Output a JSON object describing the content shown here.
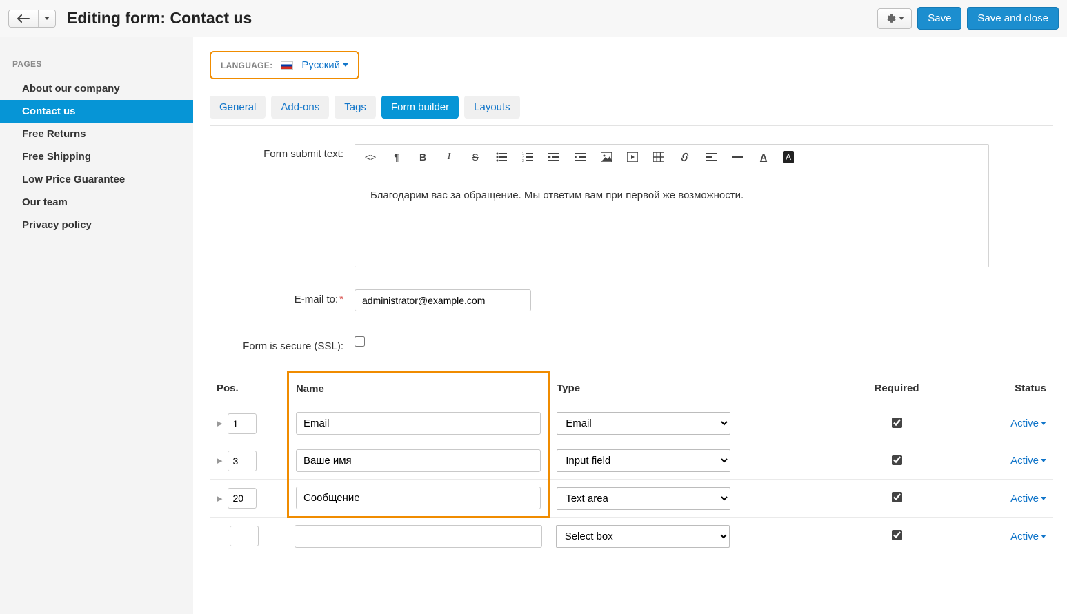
{
  "header": {
    "title": "Editing form: Contact us",
    "save_label": "Save",
    "save_close_label": "Save and close"
  },
  "sidebar": {
    "header": "PAGES",
    "items": [
      {
        "label": "About our company",
        "active": false
      },
      {
        "label": "Contact us",
        "active": true
      },
      {
        "label": "Free Returns",
        "active": false
      },
      {
        "label": "Free Shipping",
        "active": false
      },
      {
        "label": "Low Price Guarantee",
        "active": false
      },
      {
        "label": "Our team",
        "active": false
      },
      {
        "label": "Privacy policy",
        "active": false
      }
    ]
  },
  "language": {
    "label": "LANGUAGE:",
    "name": "Русский"
  },
  "tabs": [
    {
      "label": "General",
      "active": false
    },
    {
      "label": "Add-ons",
      "active": false
    },
    {
      "label": "Tags",
      "active": false
    },
    {
      "label": "Form builder",
      "active": true
    },
    {
      "label": "Layouts",
      "active": false
    }
  ],
  "form": {
    "submit_text_label": "Form submit text:",
    "submit_text_value": "Благодарим вас за обращение. Мы ответим вам при первой же возможности.",
    "email_label": "E-mail to:",
    "email_value": "administrator@example.com",
    "ssl_label": "Form is secure (SSL):",
    "ssl_checked": false
  },
  "table": {
    "headers": {
      "pos": "Pos.",
      "name": "Name",
      "type": "Type",
      "required": "Required",
      "status": "Status"
    },
    "type_options": [
      "Email",
      "Input field",
      "Text area",
      "Select box"
    ],
    "status_value": "Active",
    "rows": [
      {
        "pos": "1",
        "name": "Email",
        "type": "Email",
        "required": true
      },
      {
        "pos": "3",
        "name": "Ваше имя",
        "type": "Input field",
        "required": true
      },
      {
        "pos": "20",
        "name": "Сообщение",
        "type": "Text area",
        "required": true
      },
      {
        "pos": "",
        "name": "",
        "type": "Select box",
        "required": true
      }
    ]
  }
}
